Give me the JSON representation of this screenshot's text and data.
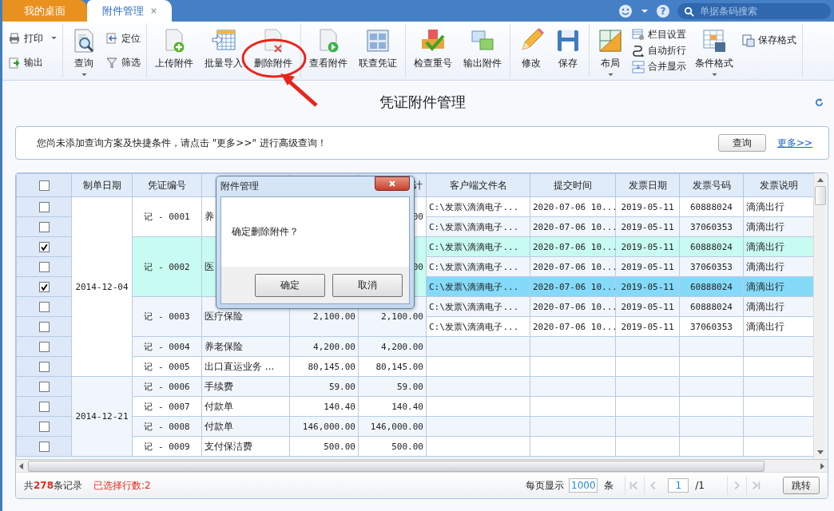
{
  "tabs": [
    {
      "label": "我的桌面",
      "selected": false,
      "closable": false
    },
    {
      "label": "附件管理",
      "selected": true,
      "closable": true
    }
  ],
  "top_right": {
    "help": "?",
    "search": {
      "placeholder": "单据条码搜索"
    }
  },
  "toolbar": {
    "groups": [
      {
        "items": [
          {
            "label": "打印",
            "kind": "small",
            "dropdown": true
          },
          {
            "label": "输出",
            "kind": "small",
            "dropdown": false
          }
        ]
      },
      {
        "items": [
          {
            "label": "查询",
            "kind": "big",
            "dropdown": true
          },
          {
            "label": "定位",
            "kind": "small",
            "dropdown": false
          },
          {
            "label": "筛选",
            "kind": "small",
            "dropdown": false
          }
        ]
      },
      {
        "items": [
          {
            "label": "上传附件",
            "kind": "big",
            "dropdown": false
          },
          {
            "label": "批量导入",
            "kind": "big",
            "dropdown": false
          },
          {
            "label": "删除附件",
            "kind": "big",
            "dropdown": false
          }
        ]
      },
      {
        "items": [
          {
            "label": "查看附件",
            "kind": "big",
            "dropdown": false
          },
          {
            "label": "联查凭证",
            "kind": "big",
            "dropdown": false
          }
        ]
      },
      {
        "items": [
          {
            "label": "检查重号",
            "kind": "big",
            "dropdown": false
          },
          {
            "label": "输出附件",
            "kind": "big",
            "dropdown": false
          }
        ]
      },
      {
        "items": [
          {
            "label": "修改",
            "kind": "big",
            "dropdown": false
          },
          {
            "label": "保存",
            "kind": "big",
            "dropdown": false
          }
        ]
      },
      {
        "items": [
          {
            "label": "布局",
            "kind": "big",
            "dropdown": true
          },
          {
            "label": "栏目设置",
            "kind": "small",
            "dropdown": false
          },
          {
            "label": "自动折行",
            "kind": "small",
            "dropdown": false
          },
          {
            "label": "合并显示",
            "kind": "small",
            "dropdown": false
          },
          {
            "label": "条件格式",
            "kind": "big",
            "dropdown": true
          },
          {
            "label": "保存格式",
            "kind": "small",
            "dropdown": false
          }
        ]
      }
    ]
  },
  "page_title": "凭证附件管理",
  "query_hint": {
    "text": "您尚未添加查询方案及快捷条件，请点击 \"更多>>\" 进行高级查询！",
    "button": "查询",
    "link": "更多>>"
  },
  "table": {
    "columns": [
      {
        "kind": "check",
        "checked": false
      },
      {
        "kind": "text",
        "label": "制单日期"
      },
      {
        "kind": "text",
        "label": "凭证编号"
      },
      {
        "kind": "blank"
      },
      {
        "kind": "blank"
      },
      {
        "kind": "text",
        "label": "计"
      },
      {
        "kind": "text",
        "label": "客户端文件名"
      },
      {
        "kind": "text",
        "label": "提交时间"
      },
      {
        "kind": "text",
        "label": "发票日期"
      },
      {
        "kind": "text",
        "label": "发票号码"
      },
      {
        "kind": "text",
        "label": "发票说明"
      }
    ],
    "groups": [
      {
        "date": "2014-12-04",
        "vouchers": [
          {
            "number": "记 - 0001",
            "column_4": "养",
            "column_6": "00",
            "hovered": false,
            "rows": [
              {
                "checked": false,
                "selected": false,
                "hovered": false,
                "client_file": "C:\\发票\\滴滴电子...",
                "submit_time": "2020-07-06 10...",
                "invoice_date": "2019-05-11",
                "invoice_number": "60888024",
                "invoice_note": "滴滴出行"
              },
              {
                "checked": false,
                "selected": false,
                "hovered": false,
                "client_file": "C:\\发票\\滴滴电子...",
                "submit_time": "2020-07-06 10...",
                "invoice_date": "2019-05-11",
                "invoice_number": "37060353",
                "invoice_note": "滴滴出行"
              }
            ]
          },
          {
            "number": "记 - 0002",
            "column_4": "医",
            "column_6": "00",
            "hovered": true,
            "rows": [
              {
                "checked": true,
                "selected": false,
                "hovered": true,
                "client_file": "C:\\发票\\滴滴电子...",
                "submit_time": "2020-07-06 10...",
                "invoice_date": "2019-05-11",
                "invoice_number": "60888024",
                "invoice_note": "滴滴出行"
              },
              {
                "checked": false,
                "selected": false,
                "hovered": false,
                "client_file": "C:\\发票\\滴滴电子...",
                "submit_time": "2020-07-06 10...",
                "invoice_date": "2019-05-11",
                "invoice_number": "37060353",
                "invoice_note": "滴滴出行"
              },
              {
                "checked": true,
                "selected": true,
                "hovered": false,
                "client_file": "C:\\发票\\滴滴电子...",
                "submit_time": "2020-07-06 10...",
                "invoice_date": "2019-05-11",
                "invoice_number": "60888024",
                "invoice_note": "滴滴出行"
              }
            ]
          },
          {
            "number": "记 - 0003",
            "column_4": "医疗保险",
            "column_5": "2,100.00",
            "column_6": "2,100.00",
            "hovered": false,
            "rows": [
              {
                "checked": false,
                "selected": false,
                "hovered": false,
                "client_file": "C:\\发票\\滴滴电子...",
                "submit_time": "2020-07-06 10...",
                "invoice_date": "2019-05-11",
                "invoice_number": "60888024",
                "invoice_note": "滴滴出行"
              },
              {
                "checked": false,
                "selected": false,
                "hovered": false,
                "client_file": "C:\\发票\\滴滴电子...",
                "submit_time": "2020-07-06 10...",
                "invoice_date": "2019-05-11",
                "invoice_number": "37060353",
                "invoice_note": "滴滴出行"
              }
            ]
          },
          {
            "number": "记 - 0004",
            "column_4": "养老保险",
            "column_5": "4,200.00",
            "column_6": "4,200.00",
            "hovered": false,
            "rows": [
              {
                "checked": false,
                "selected": false,
                "hovered": false
              }
            ]
          },
          {
            "number": "记 - 0005",
            "column_4": "出口直运业务 ...",
            "column_5": "80,145.00",
            "column_6": "80,145.00",
            "hovered": false,
            "rows": [
              {
                "checked": false,
                "selected": false,
                "hovered": false
              }
            ]
          }
        ]
      },
      {
        "date": "2014-12-21",
        "vouchers": [
          {
            "number": "记 - 0006",
            "column_4": "手续费",
            "column_5": "59.00",
            "column_6": "59.00",
            "hovered": false,
            "rows": [
              {
                "checked": false,
                "selected": false,
                "hovered": false
              }
            ]
          },
          {
            "number": "记 - 0007",
            "column_4": "付款单",
            "column_5": "140.40",
            "column_6": "140.40",
            "hovered": false,
            "rows": [
              {
                "checked": false,
                "selected": false,
                "hovered": false
              }
            ]
          },
          {
            "number": "记 - 0008",
            "column_4": "付款单",
            "column_5": "146,000.00",
            "column_6": "146,000.00",
            "hovered": false,
            "rows": [
              {
                "checked": false,
                "selected": false,
                "hovered": false
              }
            ]
          },
          {
            "number": "记 - 0009",
            "column_4": "支付保洁费",
            "column_5": "500.00",
            "column_6": "500.00",
            "hovered": false,
            "rows": [
              {
                "checked": false,
                "selected": false,
                "hovered": false
              }
            ]
          }
        ]
      }
    ]
  },
  "status": {
    "total": "共**278**条记录",
    "selected_count": "已选择行数:2"
  },
  "pager": {
    "label": "每页显示",
    "page_size": "1000",
    "unit": "条",
    "page": "1",
    "page_total": "/1",
    "jump": "跳转",
    "nav_buttons": [
      {
        "kind": "first",
        "disabled": true
      },
      {
        "kind": "prev",
        "disabled": true
      },
      {
        "kind": "next",
        "disabled": true
      },
      {
        "kind": "last",
        "disabled": true
      }
    ]
  },
  "dialog": {
    "title": "附件管理",
    "message": "确定删除附件？",
    "buttons": [
      "确定",
      "取消"
    ]
  }
}
